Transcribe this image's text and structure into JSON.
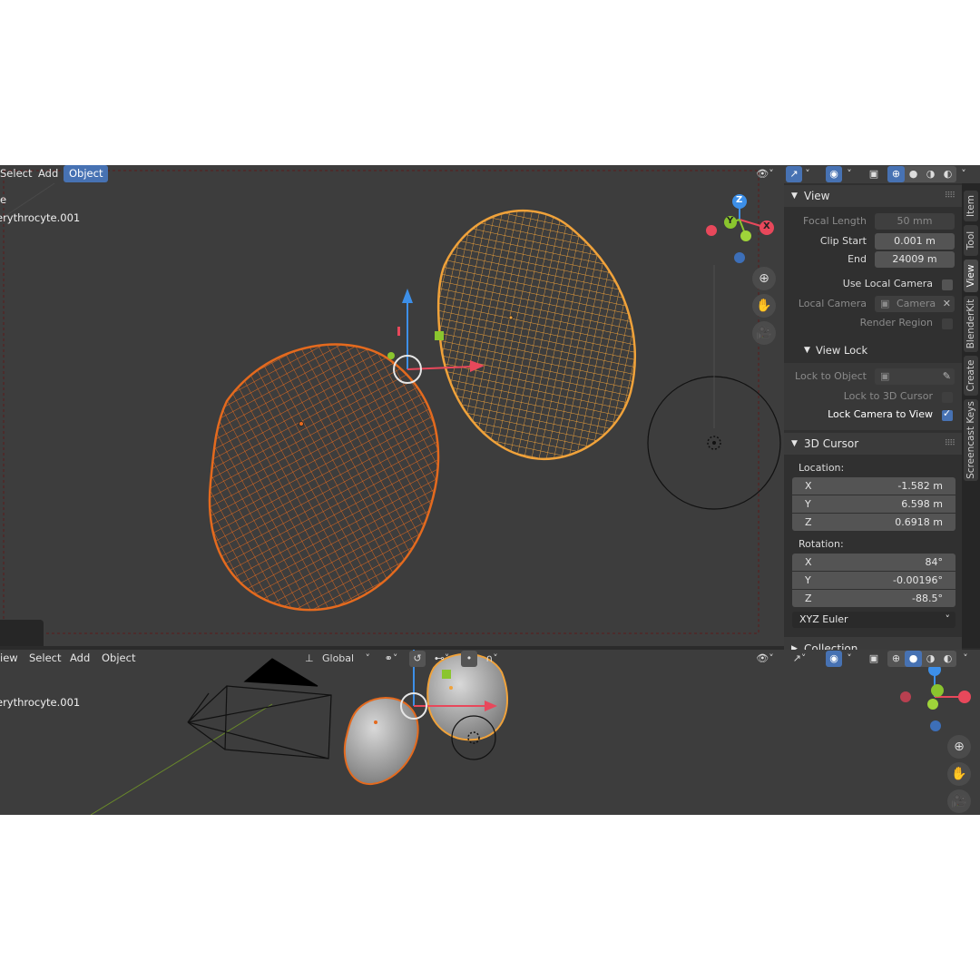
{
  "top_header": {
    "menu": [
      "Select",
      "Add",
      "Object"
    ],
    "active_menu": "Object"
  },
  "top_overlay": {
    "line1": "e",
    "line2": "erythrocyte.001"
  },
  "sidebar_tabs": [
    "Item",
    "Tool",
    "View",
    "BlenderKit",
    "Create",
    "Screencast Keys"
  ],
  "active_tab": "View",
  "view_panel": {
    "title": "View",
    "focal_length_label": "Focal Length",
    "focal_length_value": "50 mm",
    "clip_start_label": "Clip Start",
    "clip_start_value": "0.001 m",
    "end_label": "End",
    "end_value": "24009 m",
    "use_local_camera_label": "Use Local Camera",
    "local_camera_label": "Local Camera",
    "local_camera_value": "Camera",
    "render_region_label": "Render Region"
  },
  "view_lock": {
    "title": "View Lock",
    "lock_to_object_label": "Lock to Object",
    "lock_to_3d_cursor_label": "Lock to 3D Cursor",
    "lock_camera_to_view_label": "Lock Camera to View",
    "lock_camera_to_view_checked": true
  },
  "cursor_panel": {
    "title": "3D Cursor",
    "location_label": "Location:",
    "location": [
      {
        "axis": "X",
        "value": "-1.582 m"
      },
      {
        "axis": "Y",
        "value": "6.598 m"
      },
      {
        "axis": "Z",
        "value": "0.6918 m"
      }
    ],
    "rotation_label": "Rotation:",
    "rotation": [
      {
        "axis": "X",
        "value": "84°"
      },
      {
        "axis": "Y",
        "value": "-0.00196°"
      },
      {
        "axis": "Z",
        "value": "-88.5°"
      }
    ],
    "rotation_mode": "XYZ Euler",
    "collection_label": "Collection"
  },
  "gizmo": {
    "z": "Z",
    "y": "Y",
    "x": "X"
  },
  "bottom_header": {
    "menu": [
      "iew",
      "Select",
      "Add",
      "Object"
    ],
    "transform_orientation": "Global"
  },
  "bottom_overlay": {
    "line1": "erythrocyte.001"
  },
  "colors": {
    "accent": "#4772b3",
    "selected_active": "#f0a23a",
    "selected": "#e46a1e",
    "axis_x": "#e8485b",
    "axis_y": "#8ac52e",
    "axis_z": "#3d8fe8"
  }
}
